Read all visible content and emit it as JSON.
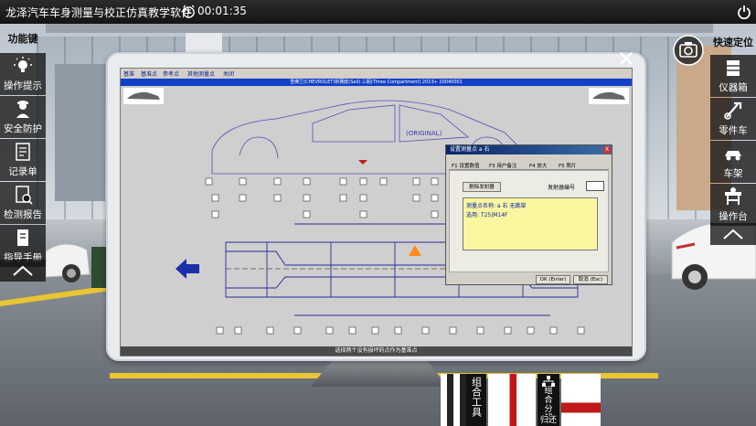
{
  "app": {
    "title": "龙泽汽车车身测量与校正仿真教学软件",
    "timer": "00:01:35"
  },
  "left_toolbar": {
    "header": "功能键",
    "items": [
      {
        "label": "操作提示",
        "icon": "lightbulb-icon"
      },
      {
        "label": "安全防护",
        "icon": "worker-icon"
      },
      {
        "label": "记录单",
        "icon": "record-icon"
      },
      {
        "label": "检测报告",
        "icon": "report-icon"
      },
      {
        "label": "指导手册",
        "icon": "manual-icon"
      }
    ]
  },
  "right_toolbar": {
    "header": "快速定位",
    "items": [
      {
        "label": "仪器箱",
        "icon": "toolbox-icon"
      },
      {
        "label": "零件车",
        "icon": "parts-cart-icon"
      },
      {
        "label": "车架",
        "icon": "car-frame-icon"
      },
      {
        "label": "操作台",
        "icon": "workbench-icon"
      }
    ]
  },
  "software": {
    "menu": [
      "基准",
      "基准点",
      "参考点",
      "其他测量点",
      "关闭"
    ],
    "title": "雪佛兰(CHEVROLET)新赛欧(Sail) 三厢(Three Compartment) 2013+ 20040001",
    "watermark": "(ORIGINAL)",
    "status": "选择两个没有损坏的点作为基准点",
    "point_label_cells": 37
  },
  "dialog": {
    "title": "设置测量点  a 右",
    "close": "X",
    "tabs": [
      "F1 设置数值",
      "F3 用户备注",
      "F4 放大",
      "F5 照片"
    ],
    "delete_button": "删除发射器",
    "emitter_label": "发射器编号",
    "point_name": "测量点名称: a 右 无跳架",
    "selection": "选用: T25|M14F",
    "ok": "OK (Enter)",
    "cancel": "取消 (Esc)"
  },
  "bottom_tools": {
    "combine_tool": "组合工具",
    "combine_split": "组合分解",
    "return": "归还"
  },
  "colors": {
    "toolbar_bg": "#1a1a1a",
    "sw_blue": "#1240c8",
    "dialog_info": "#fbf7a0",
    "arrow": "#1a2fa8"
  }
}
